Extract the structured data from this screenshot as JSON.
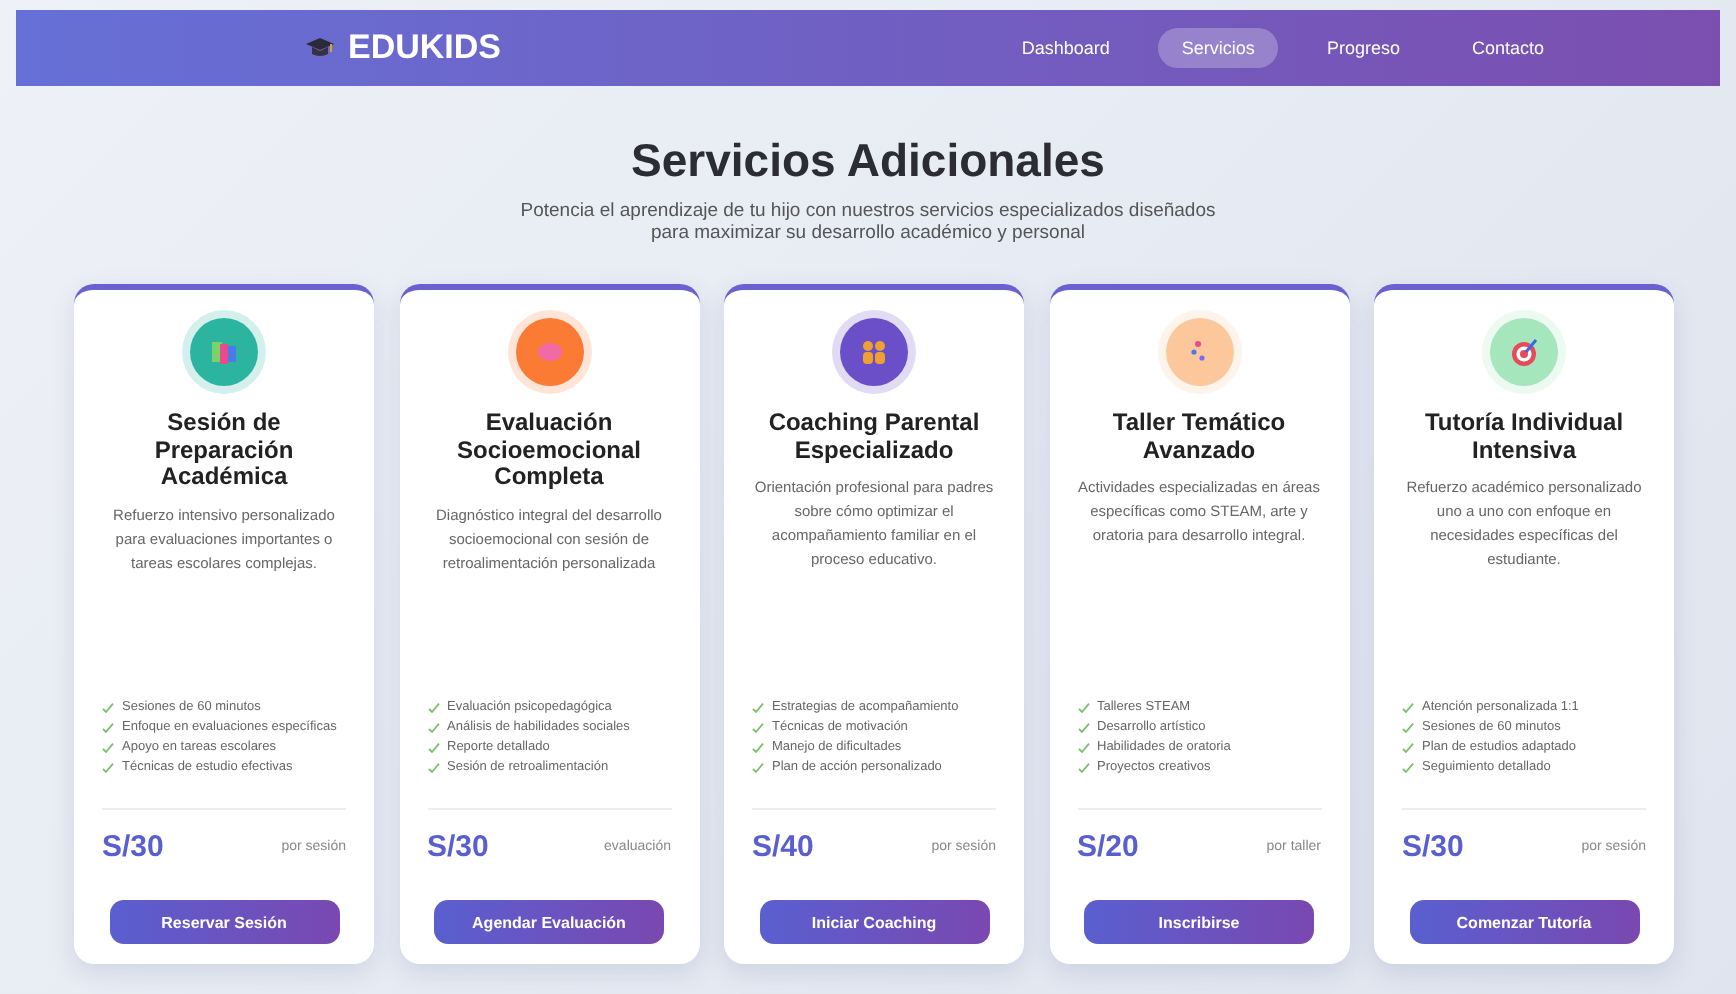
{
  "brand": "EDUKIDS",
  "nav": [
    {
      "label": "Dashboard",
      "selected": false
    },
    {
      "label": "Servicios",
      "selected": true
    },
    {
      "label": "Progreso",
      "selected": false
    },
    {
      "label": "Contacto",
      "selected": false
    }
  ],
  "heading": "Servicios Adicionales",
  "subtitle": "Potencia el aprendizaje de tu hijo con nuestros servicios especializados diseñados para maximizar su desarrollo académico y personal",
  "services": [
    {
      "title": "Sesión de Preparación Académica",
      "color": "#2bb5a0",
      "description": "Refuerzo intensivo personalizado para evaluaciones importantes o tareas escolares complejas.",
      "features": [
        "Sesiones de 60 minutos",
        "Enfoque en evaluaciones específicas",
        "Apoyo en tareas escolares",
        "Técnicas de estudio efectivas"
      ],
      "price": "S/30",
      "unit": "por sesión",
      "button": "Reservar Sesión"
    },
    {
      "title": "Evaluación Socioemocional Completa",
      "color": "#fb7b35",
      "description": "Diagnóstico integral del desarrollo socioemocional con sesión de retroalimentación personalizada",
      "features": [
        "Evaluación psicopedagógica",
        "Análisis de habilidades sociales",
        "Reporte detallado",
        "Sesión de retroalimentación"
      ],
      "price": "S/30",
      "unit": "evaluación",
      "button": "Agendar Evaluación"
    },
    {
      "title": "Coaching Parental Especializado",
      "color": "#6a4fc9",
      "description": "Orientación profesional para padres sobre cómo optimizar el acompañamiento familiar en el proceso educativo.",
      "features": [
        "Estrategias de acompañamiento",
        "Técnicas de motivación",
        "Manejo de dificultades",
        "Plan de acción personalizado"
      ],
      "price": "S/40",
      "unit": "por sesión",
      "button": "Iniciar Coaching"
    },
    {
      "title": "Taller Temático Avanzado",
      "color": "#fcc79a",
      "description": "Actividades especializadas en áreas específicas como STEAM, arte y oratoria para desarrollo integral.",
      "features": [
        "Talleres STEAM",
        "Desarrollo artístico",
        "Habilidades de oratoria",
        "Proyectos creativos"
      ],
      "price": "S/20",
      "unit": "por taller",
      "button": "Inscribirse"
    },
    {
      "title": "Tutoría Individual Intensiva",
      "color": "#a6e6bd",
      "description": "Refuerzo académico personalizado uno a uno con enfoque en necesidades específicas del estudiante.",
      "features": [
        "Atención personalizada 1:1",
        "Sesiones de 60 minutos",
        "Plan de estudios adaptado",
        "Seguimiento detallado"
      ],
      "price": "S/30",
      "unit": "por sesión",
      "button": "Comenzar Tutoría"
    }
  ]
}
